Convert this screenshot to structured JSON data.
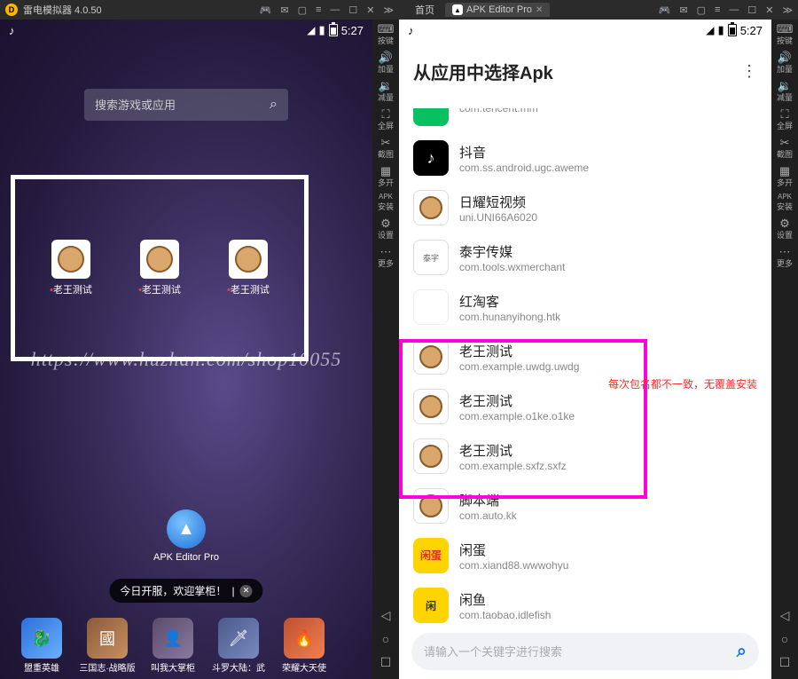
{
  "left": {
    "title": "雷电模拟器 4.0.50",
    "statusTime": "5:27",
    "searchPlaceholder": "搜索游戏或应用",
    "deskApps": [
      {
        "label": "老王测试"
      },
      {
        "label": "老王测试"
      },
      {
        "label": "老王测试"
      }
    ],
    "apkEditorLabel": "APK Editor Pro",
    "pill": "今日开服，欢迎掌柜！",
    "watermark": "https://www.huzhan.com/shop10055",
    "dock": [
      {
        "label": "盟重英雄"
      },
      {
        "label": "三国志·战略版"
      },
      {
        "label": "叫我大掌柜"
      },
      {
        "label": "斗罗大陆：武"
      },
      {
        "label": "荣耀大天使"
      }
    ]
  },
  "right": {
    "tabs": {
      "home": "首页",
      "active": "APK Editor Pro"
    },
    "statusTime": "5:27",
    "header": "从应用中选择Apk",
    "annotation": "每次包名都不一致，无覆盖安装",
    "searchPlaceholder": "请输入一个关键字进行搜索",
    "apps": [
      {
        "name": "",
        "pkg": "com.tencent.mm",
        "cls": "ico-wechat",
        "partial": true
      },
      {
        "name": "抖音",
        "pkg": "com.ss.android.ugc.aweme",
        "cls": "ico-douyin"
      },
      {
        "name": "日耀短视频",
        "pkg": "uni.UNI66A6020",
        "cls": "ico-sun"
      },
      {
        "name": "泰宇传媒",
        "pkg": "com.tools.wxmerchant",
        "cls": "ico-taiyu"
      },
      {
        "name": "红淘客",
        "pkg": "com.hunanyihong.htk",
        "cls": "ico-hongtao"
      },
      {
        "name": "老王测试",
        "pkg": "com.example.uwdg.uwdg",
        "cls": "ico-sun"
      },
      {
        "name": "老王测试",
        "pkg": "com.example.o1ke.o1ke",
        "cls": "ico-sun"
      },
      {
        "name": "老王测试",
        "pkg": "com.example.sxfz.sxfz",
        "cls": "ico-sun"
      },
      {
        "name": "脚本端",
        "pkg": "com.auto.kk",
        "cls": "ico-sun"
      },
      {
        "name": "闲蛋",
        "pkg": "com.xiand88.wwwohyu",
        "cls": "ico-xiandan"
      },
      {
        "name": "闲鱼",
        "pkg": "com.taobao.idlefish",
        "cls": "ico-xianyu"
      }
    ]
  },
  "sideTools": [
    {
      "ico": "⌨",
      "label": "按键"
    },
    {
      "ico": "🔊+",
      "label": "加量"
    },
    {
      "ico": "🔊-",
      "label": "减量"
    },
    {
      "ico": "⛶",
      "label": "全屏"
    },
    {
      "ico": "✂",
      "label": "截图"
    },
    {
      "ico": "▦",
      "label": "多开"
    },
    {
      "ico": "APK",
      "label": "安装"
    },
    {
      "ico": "⚙",
      "label": "设置"
    },
    {
      "ico": "⋯",
      "label": "更多"
    }
  ]
}
